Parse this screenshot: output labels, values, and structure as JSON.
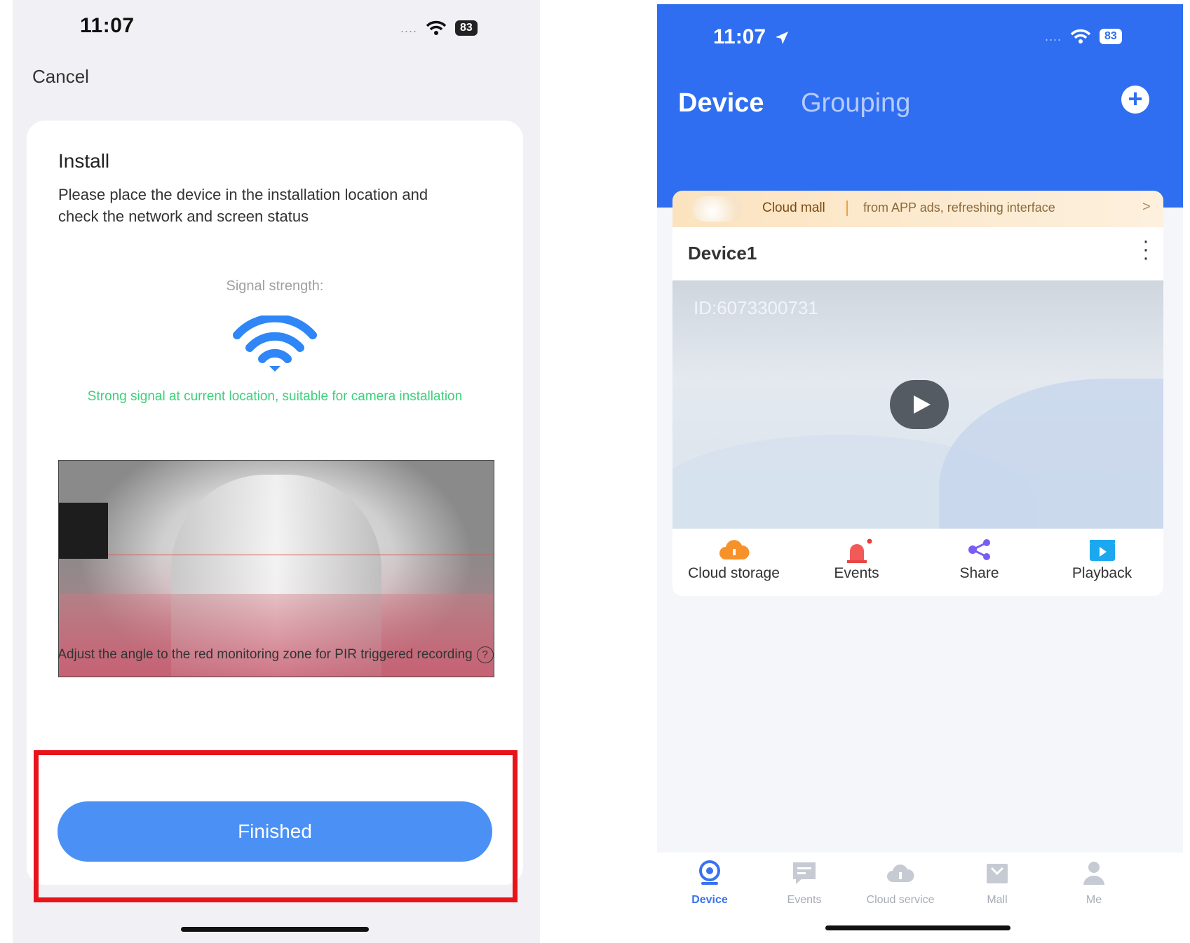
{
  "left": {
    "status": {
      "time": "11:07",
      "signal_dots": "....",
      "battery": "83"
    },
    "cancel": "Cancel",
    "title": "Install",
    "description": "Please place the device in the installation location and check the network and screen status",
    "signal_label": "Signal strength:",
    "signal_message": "Strong signal at current location, suitable for camera installation",
    "adjust_text": "Adjust the angle to the red monitoring zone for PIR triggered recording",
    "help_glyph": "?",
    "finished_button": "Finished",
    "colors": {
      "accent": "#4b90f5",
      "signal_ok": "#3fcf7a",
      "highlight": "#e8141b"
    }
  },
  "right": {
    "status": {
      "time": "11:07",
      "signal_dots": "....",
      "battery": "83"
    },
    "tabs": {
      "device": "Device",
      "grouping": "Grouping"
    },
    "add_glyph": "+",
    "banner": {
      "title": "Cloud mall",
      "text": "from APP ads, refreshing interface",
      "chevron": ">"
    },
    "device": {
      "name": "Device1",
      "id": "ID:6073300731"
    },
    "actions": [
      {
        "label": "Cloud storage",
        "icon": "cloud-storage-icon"
      },
      {
        "label": "Events",
        "icon": "alarm-icon"
      },
      {
        "label": "Share",
        "icon": "share-icon"
      },
      {
        "label": "Playback",
        "icon": "playback-icon"
      }
    ],
    "tabbar": [
      {
        "label": "Device",
        "icon": "camera-icon",
        "active": true
      },
      {
        "label": "Events",
        "icon": "message-icon",
        "active": false
      },
      {
        "label": "Cloud service",
        "icon": "cloud-icon",
        "active": false
      },
      {
        "label": "Mall",
        "icon": "mall-icon",
        "active": false
      },
      {
        "label": "Me",
        "icon": "person-icon",
        "active": false
      }
    ],
    "colors": {
      "header": "#2f6ef0",
      "active_tab": "#3a72f0"
    }
  }
}
